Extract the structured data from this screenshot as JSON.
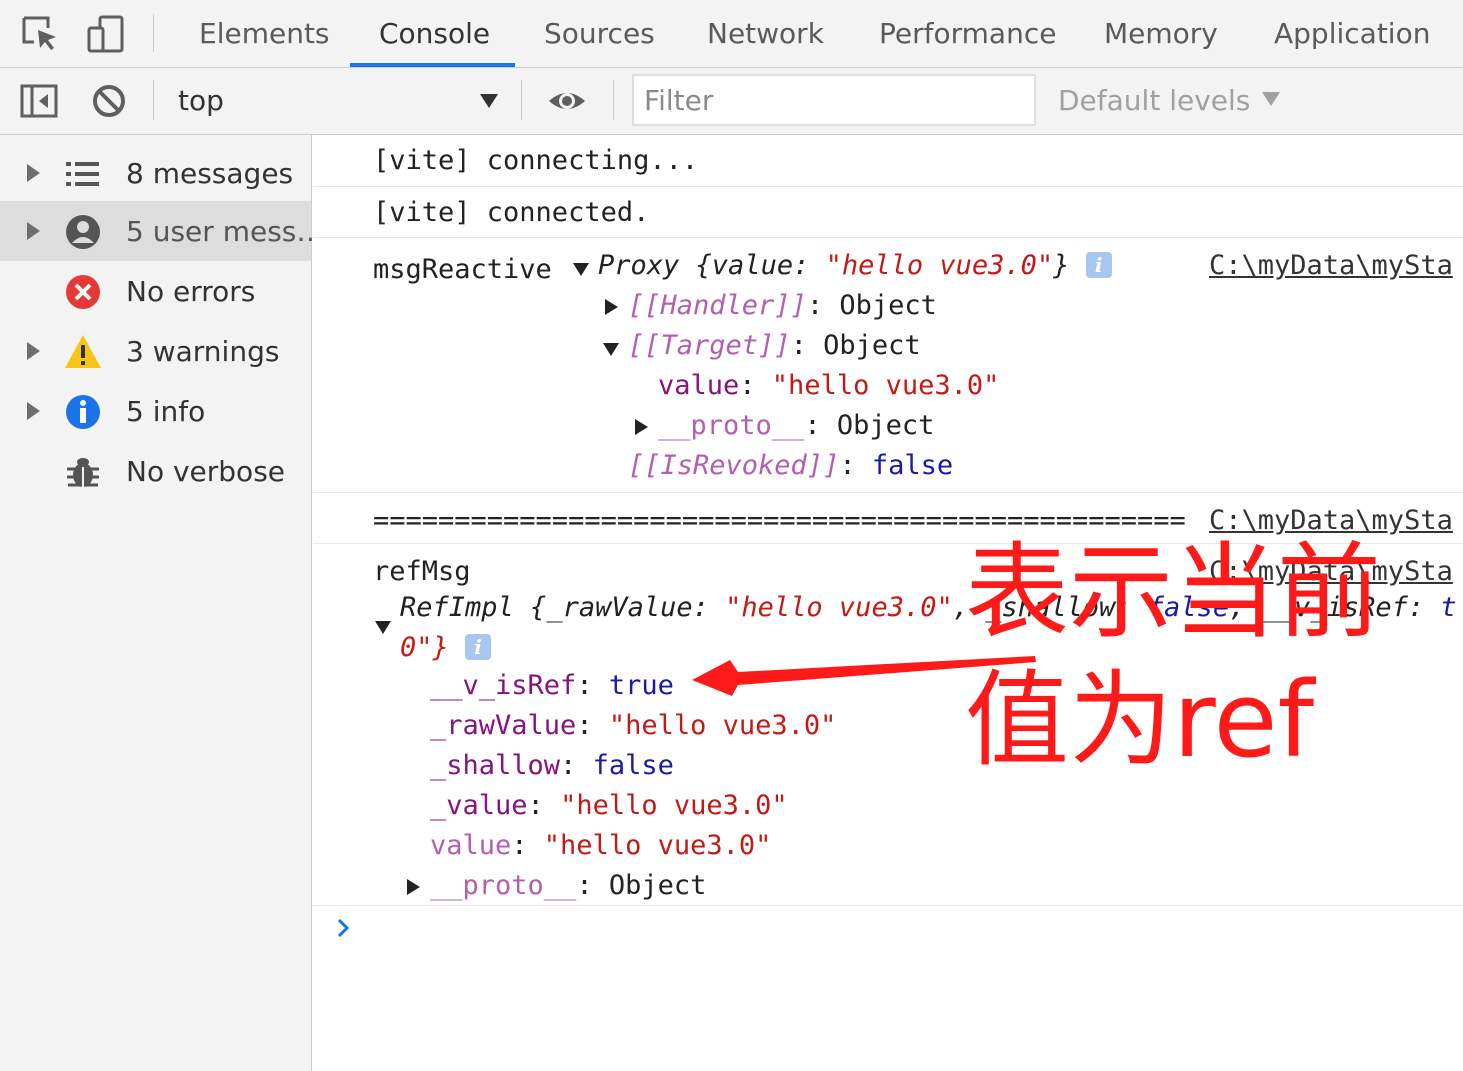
{
  "tabbar": {
    "tabs": [
      {
        "label": "Elements"
      },
      {
        "label": "Console"
      },
      {
        "label": "Sources"
      },
      {
        "label": "Network"
      },
      {
        "label": "Performance"
      },
      {
        "label": "Memory"
      },
      {
        "label": "Application"
      }
    ],
    "active_tab": "Console"
  },
  "toolbar": {
    "context": "top",
    "filter_placeholder": "Filter",
    "filter_value": "",
    "levels_label": "Default levels"
  },
  "sidebar": {
    "items": [
      {
        "label": "8 messages",
        "icon": "list-icon",
        "selected": false
      },
      {
        "label": "5 user mess…",
        "icon": "user-icon",
        "selected": true
      },
      {
        "label": "No errors",
        "icon": "error-icon",
        "selected": false
      },
      {
        "label": "3 warnings",
        "icon": "warning-icon",
        "selected": false
      },
      {
        "label": "5 info",
        "icon": "info-icon",
        "selected": false
      },
      {
        "label": "No verbose",
        "icon": "bug-icon",
        "selected": false
      }
    ]
  },
  "console": {
    "vite_connecting": "[vite] connecting...",
    "vite_connected": "[vite] connected.",
    "source_link": "C:\\myData\\mySta",
    "msg_reactive": {
      "label": "msgReactive",
      "proxy_head": "Proxy {",
      "proxy_key": "value",
      "proxy_value": "\"hello vue3.0\"",
      "proxy_close": "}",
      "handler_key": "[[Handler]]",
      "handler_value": "Object",
      "target_key": "[[Target]]",
      "target_value": "Object",
      "value_key": "value",
      "value_value": "\"hello vue3.0\"",
      "proto_key": "__proto__",
      "proto_value": "Object",
      "revoked_key": "[[IsRevoked]]",
      "revoked_value": "false"
    },
    "separator": "==================================================",
    "ref_msg": {
      "label": "refMsg",
      "head_class": "RefImpl {",
      "head_raw_key": "_rawValue",
      "head_raw_value": "\"hello vue3.0\"",
      "head_shallow_key": "_shallow",
      "head_shallow_value": "false",
      "head_isref_key": "__v_isRef",
      "head_isref_value": "t",
      "head_wrap": "0\"}",
      "isref_key": "__v_isRef",
      "isref_value": "true",
      "rawvalue_key": "_rawValue",
      "rawvalue_value": "\"hello vue3.0\"",
      "shallow_key": "_shallow",
      "shallow_value": "false",
      "_value_key": "_value",
      "_value_value": "\"hello vue3.0\"",
      "value_key": "value",
      "value_value": "\"hello vue3.0\"",
      "proto_key": "__proto__",
      "proto_value": "Object"
    }
  },
  "annotation": {
    "line1": "表示当前",
    "line2": "值为ref",
    "color": "#ff1a1a"
  }
}
